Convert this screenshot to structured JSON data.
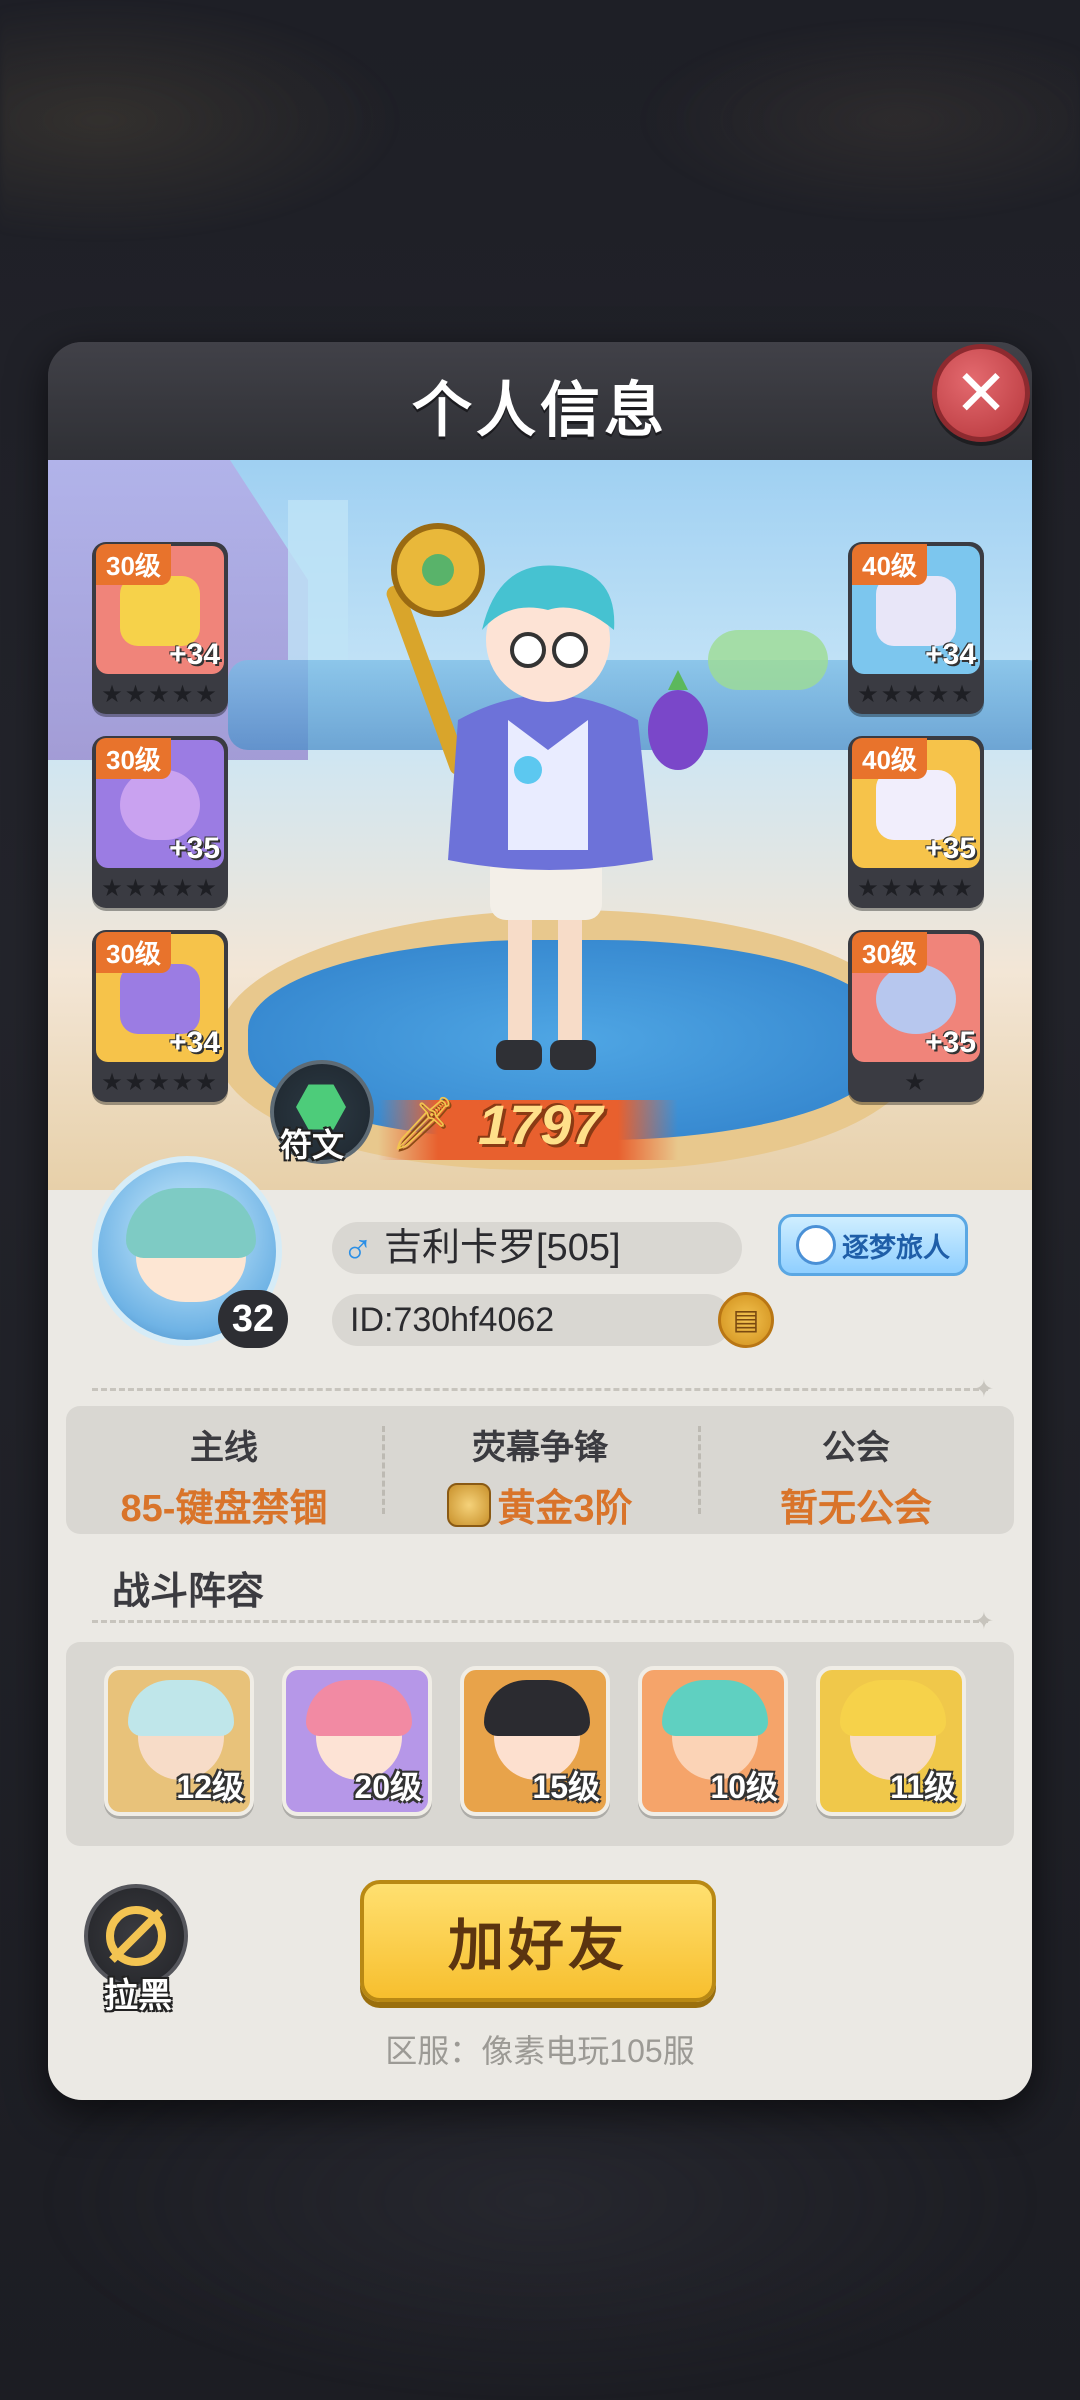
{
  "dialog": {
    "title": "个人信息",
    "close_icon": "close-icon"
  },
  "equipment": {
    "left": [
      {
        "level": "30级",
        "plus": "+34",
        "icon": "helmet-icon",
        "color": "#f0847a"
      },
      {
        "level": "30级",
        "plus": "+35",
        "icon": "bracer-icon",
        "color": "#9b7ce3"
      },
      {
        "level": "30级",
        "plus": "+34",
        "icon": "boots-icon",
        "color": "#f6c34a"
      }
    ],
    "right": [
      {
        "level": "40级",
        "plus": "+34",
        "icon": "jacket-icon",
        "color": "#7cc6ee"
      },
      {
        "level": "40级",
        "plus": "+35",
        "icon": "pants-icon",
        "color": "#f6c34a"
      },
      {
        "level": "30级",
        "plus": "+35",
        "icon": "orb-accessory-icon",
        "color": "#f0847a"
      }
    ],
    "star_slots": "★★★★★"
  },
  "rune": {
    "label": "符文",
    "icon": "rune-hexagon-icon"
  },
  "power": {
    "value": "1797",
    "icon": "sword-icon"
  },
  "profile": {
    "level": "32",
    "gender_symbol": "♂",
    "name": "吉利卡罗[505]",
    "title_badge": "逐梦旅人",
    "id": "ID:730hf4062",
    "copy_icon": "copy-icon"
  },
  "stats": [
    {
      "label": "主线",
      "value": "85-键盘禁锢"
    },
    {
      "label": "荧幕争锋",
      "value": "黄金3阶",
      "icon": "rank-gold-icon"
    },
    {
      "label": "公会",
      "value": "暂无公会"
    }
  ],
  "lineup": {
    "title": "战斗阵容",
    "heroes": [
      {
        "level": "12级",
        "bg": "#e8c27a",
        "hair": "#bfe6ea",
        "skin": "#f7dcc8"
      },
      {
        "level": "20级",
        "bg": "#b697e8",
        "hair": "#f28aa3",
        "skin": "#fde3d5"
      },
      {
        "level": "15级",
        "bg": "#e8a34a",
        "hair": "#2b2b30",
        "skin": "#fde0cf"
      },
      {
        "level": "10级",
        "bg": "#f5a46a",
        "hair": "#5fd0c1",
        "skin": "#fbd3b6"
      },
      {
        "level": "11级",
        "bg": "#f0c84a",
        "hair": "#f6d24a",
        "skin": "#f7dcc8"
      }
    ]
  },
  "actions": {
    "block_label": "拉黑",
    "block_icon": "block-icon",
    "add_friend_label": "加好友"
  },
  "server": "区服：像素电玩105服"
}
